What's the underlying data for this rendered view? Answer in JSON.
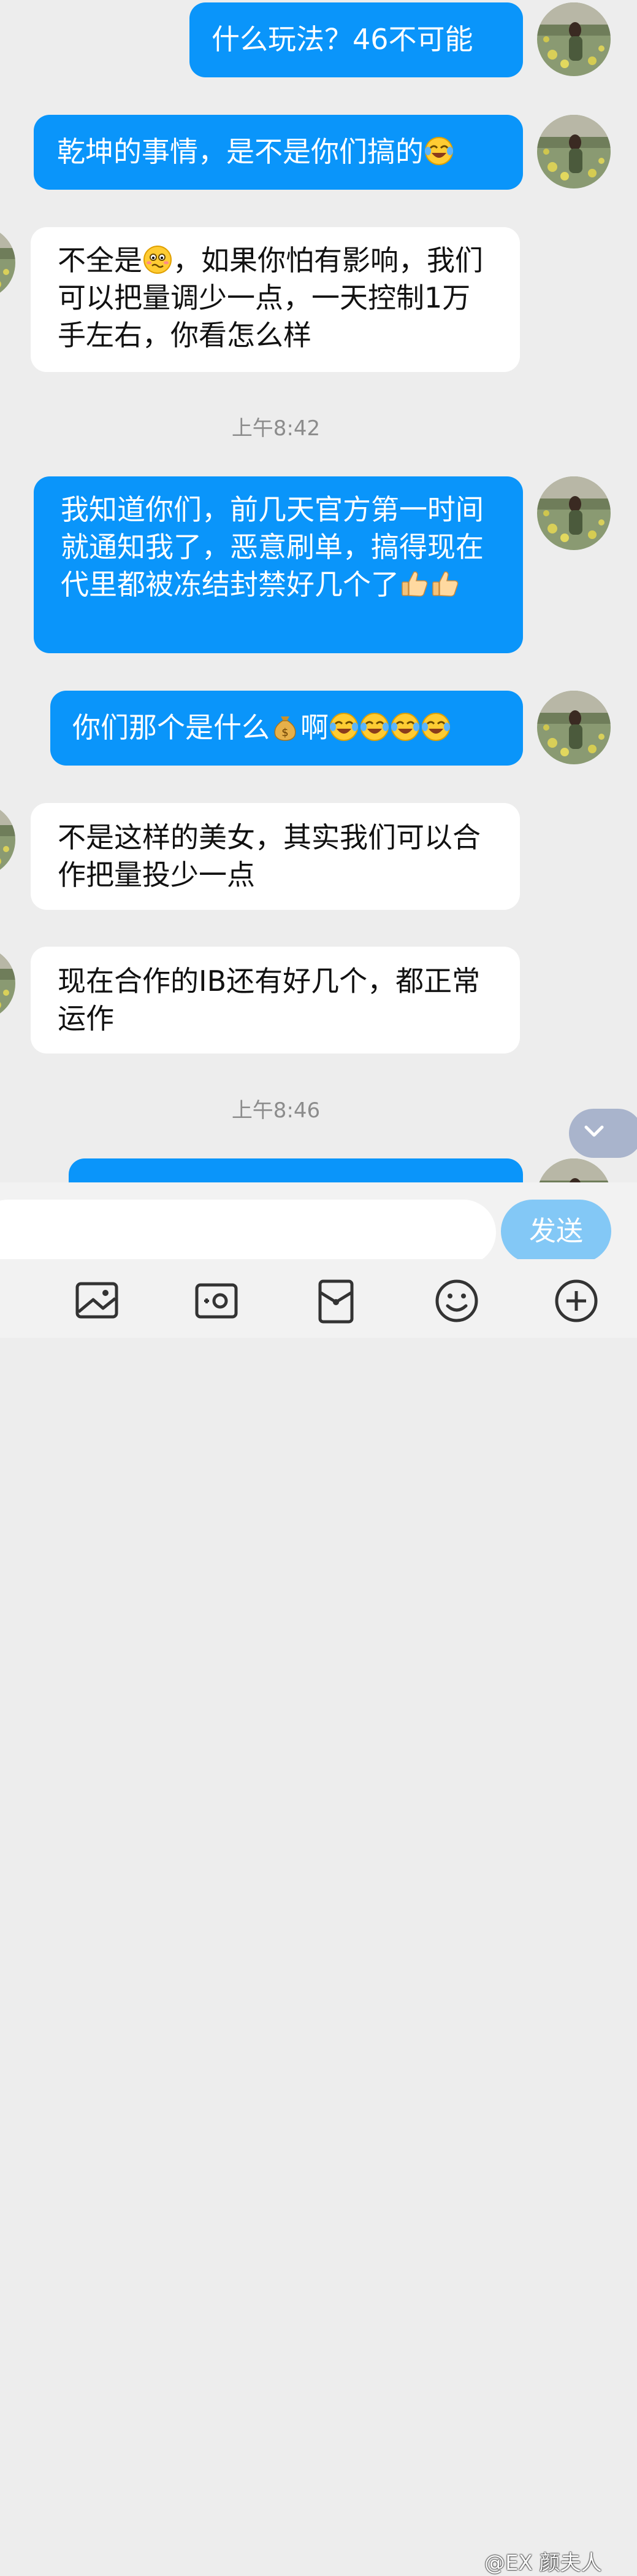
{
  "messages": [
    {
      "side": "out",
      "text": "什么玩法？46不可能"
    },
    {
      "side": "out",
      "text": "乾坤的事情，是不是你们搞的",
      "emoji_after": [
        "laugh-cry"
      ]
    },
    {
      "side": "in",
      "text_before": "不全是",
      "emoji_mid": "awkward",
      "text_after": "，如果你怕有影响，我们可以把量调少一点，一天控制1万手左右，你看怎么样"
    },
    {
      "side": "out",
      "text": "我知道你们，前几天官方第一时间就通知我了，恶意刷单，搞得现在代里都被冻结封禁好几个了",
      "emoji_after": [
        "thumbs-up",
        "thumbs-up"
      ]
    },
    {
      "side": "out",
      "text_before": "你们那个是什么",
      "emoji_mid": "money-bag",
      "text_after": "啊",
      "emoji_after": [
        "laugh-cry",
        "laugh-cry",
        "laugh-cry",
        "laugh-cry"
      ]
    },
    {
      "side": "in",
      "text": "不是这样的美女，其实我们可以合作把量投少一点"
    },
    {
      "side": "in",
      "text": "现在合作的IB还有好几个，都正常运作"
    }
  ],
  "timestamps": [
    "上午8:42",
    "上午8:46"
  ],
  "input": {
    "placeholder": "",
    "send_label": "发送"
  },
  "toolbar": [
    "image-icon",
    "camera-icon",
    "red-packet-icon",
    "emoji-icon",
    "more-icon"
  ],
  "watermark": "@EX 颜夫人",
  "colors": {
    "outgoing": "#0a95fa",
    "incoming": "#ffffff",
    "background": "#ededed",
    "send": "#83c8f6"
  }
}
